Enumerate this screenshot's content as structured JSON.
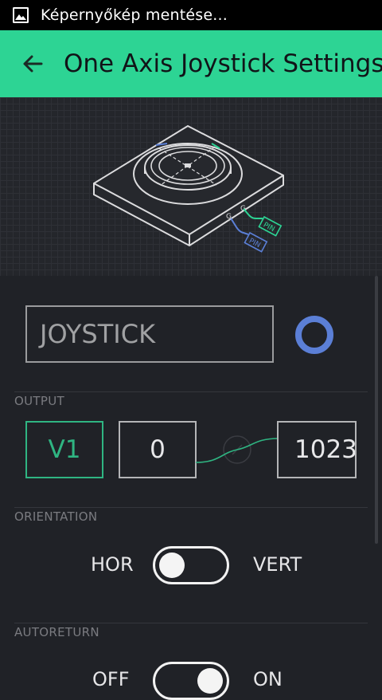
{
  "status_bar": {
    "notification_icon": "image-icon",
    "text": "Képernyőkép mentése..."
  },
  "app_bar": {
    "back_icon": "arrow-left-icon",
    "title": "One Axis Joystick Settings",
    "color": "#2dd494"
  },
  "illustration": {
    "pin_labels": [
      "PIN",
      "PIN"
    ],
    "accent_green": "#2dd494",
    "accent_blue": "#5b7fd6"
  },
  "settings": {
    "name_value": "JOYSTICK",
    "widget_color": "#5b7fd6",
    "output": {
      "label": "OUTPUT",
      "pin": "V1",
      "min": "0",
      "max": "1023"
    },
    "orientation": {
      "label": "ORIENTATION",
      "left_label": "HOR",
      "right_label": "VERT",
      "state": "off"
    },
    "autoreturn": {
      "label": "AUTORETURN",
      "left_label": "OFF",
      "right_label": "ON",
      "state": "on"
    }
  }
}
